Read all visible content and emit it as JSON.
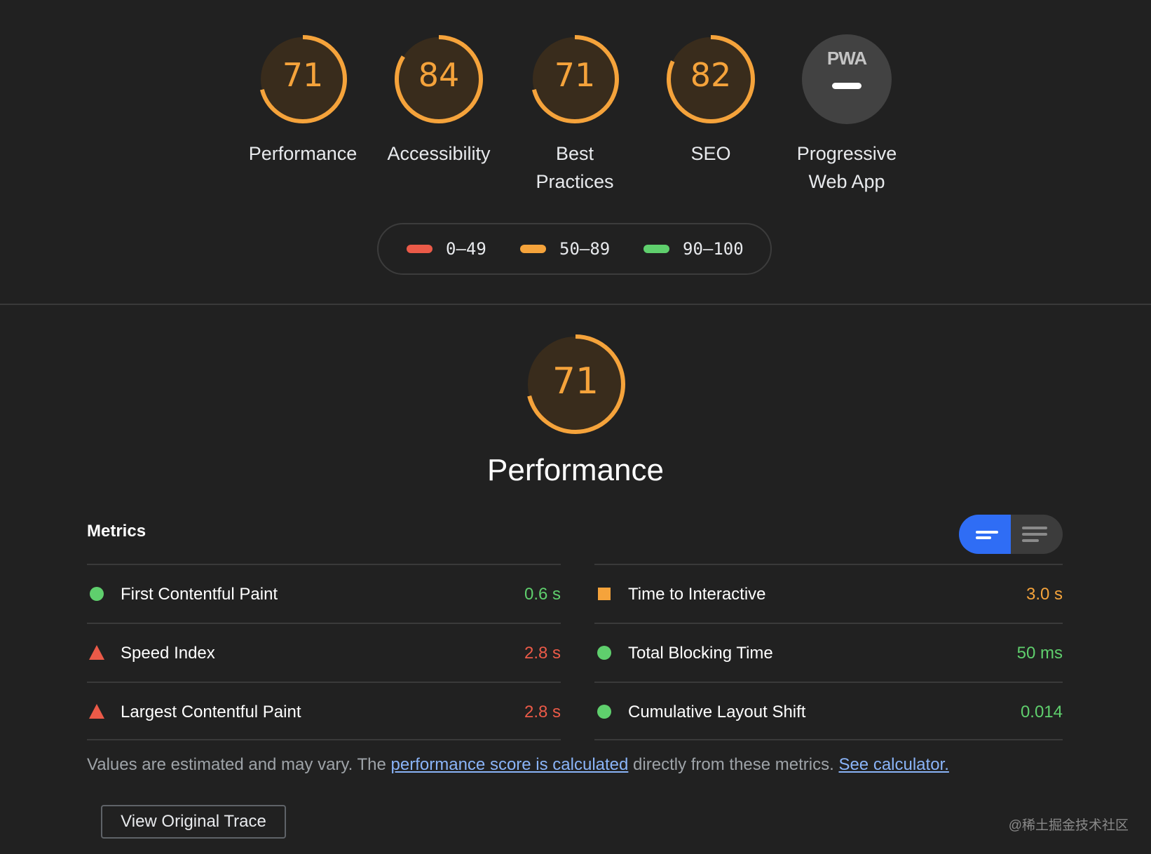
{
  "gauges": [
    {
      "score": "71",
      "label": "Performance",
      "fraction": 0.71
    },
    {
      "score": "84",
      "label": "Accessibility",
      "fraction": 0.84
    },
    {
      "score": "71",
      "label": "Best\nPractices",
      "fraction": 0.71
    },
    {
      "score": "82",
      "label": "SEO",
      "fraction": 0.82
    }
  ],
  "pwa": {
    "logo_text": "PWA",
    "label": "Progressive\nWeb App"
  },
  "legend": [
    {
      "range": "0–49",
      "color": "#eb5a48"
    },
    {
      "range": "50–89",
      "color": "#f5a33b"
    },
    {
      "range": "90–100",
      "color": "#5fcf6d"
    }
  ],
  "category": {
    "score": "71",
    "fraction": 0.71,
    "title": "Performance"
  },
  "metrics_title": "Metrics",
  "metrics": {
    "left": [
      {
        "label": "First Contentful Paint",
        "value": "0.6 s",
        "status": "pass",
        "color": "#5fcf6d"
      },
      {
        "label": "Speed Index",
        "value": "2.8 s",
        "status": "fail",
        "color": "#eb5a48"
      },
      {
        "label": "Largest Contentful Paint",
        "value": "2.8 s",
        "status": "fail",
        "color": "#eb5a48"
      }
    ],
    "right": [
      {
        "label": "Time to Interactive",
        "value": "3.0 s",
        "status": "average",
        "color": "#f5a33b"
      },
      {
        "label": "Total Blocking Time",
        "value": "50 ms",
        "status": "pass",
        "color": "#5fcf6d"
      },
      {
        "label": "Cumulative Layout Shift",
        "value": "0.014",
        "status": "pass",
        "color": "#5fcf6d"
      }
    ]
  },
  "note": {
    "prefix": "Values are estimated and may vary. The ",
    "link1": "performance score is calculated",
    "middle": " directly from these metrics. ",
    "link2": "See calculator."
  },
  "trace_button": "View Original Trace",
  "watermark": "@稀土掘金技术社区",
  "colors": {
    "average": "#f5a33b",
    "pass": "#5fcf6d",
    "fail": "#eb5a48",
    "toggle_active": "#2f6df5",
    "link": "#8ab4f8"
  }
}
